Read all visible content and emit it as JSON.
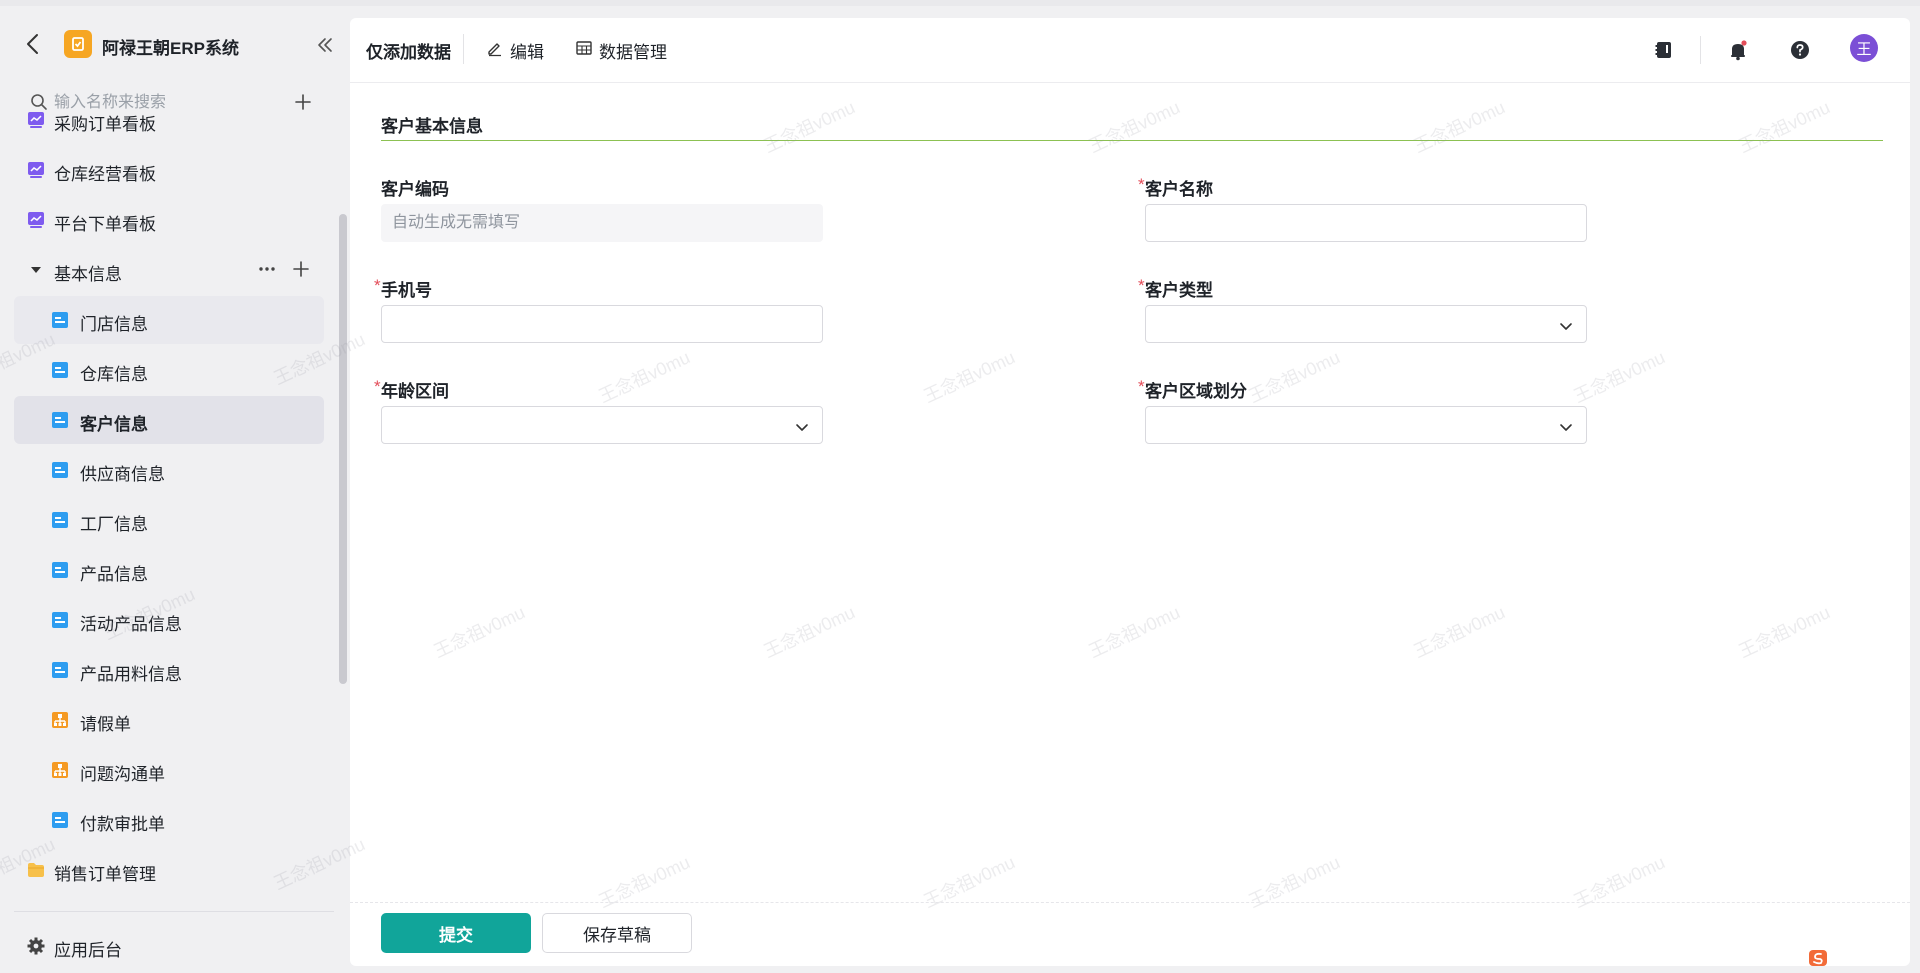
{
  "app": {
    "title": "阿禄王朝ERP系统"
  },
  "search": {
    "placeholder": "输入名称来搜索"
  },
  "sidebar": {
    "items": [
      {
        "label": "采购订单看板",
        "icon": "dashboard-icon"
      },
      {
        "label": "仓库经营看板",
        "icon": "dashboard-icon"
      },
      {
        "label": "平台下单看板",
        "icon": "dashboard-icon"
      },
      {
        "label": "基本信息",
        "icon": "caret-down-icon",
        "group": true
      },
      {
        "label": "门店信息",
        "icon": "form-icon"
      },
      {
        "label": "仓库信息",
        "icon": "form-icon"
      },
      {
        "label": "客户信息",
        "icon": "form-icon",
        "selected": true
      },
      {
        "label": "供应商信息",
        "icon": "form-icon"
      },
      {
        "label": "工厂信息",
        "icon": "form-icon"
      },
      {
        "label": "产品信息",
        "icon": "form-icon"
      },
      {
        "label": "活动产品信息",
        "icon": "form-icon"
      },
      {
        "label": "产品用料信息",
        "icon": "form-icon"
      },
      {
        "label": "请假单",
        "icon": "workflow-icon"
      },
      {
        "label": "问题沟通单",
        "icon": "workflow-icon"
      },
      {
        "label": "付款审批单",
        "icon": "form-icon"
      },
      {
        "label": "销售订单管理",
        "icon": "folder-icon"
      }
    ],
    "footer": {
      "label": "应用后台",
      "icon": "gear-icon"
    }
  },
  "toolbar": {
    "tabs": [
      {
        "label": "仅添加数据",
        "active": true
      },
      {
        "label": "编辑",
        "icon": "edit-icon"
      },
      {
        "label": "数据管理",
        "icon": "table-icon"
      }
    ],
    "avatar": "王"
  },
  "form": {
    "section_title": "客户基本信息",
    "fields": {
      "customer_code": {
        "label": "客户编码",
        "placeholder": "自动生成无需填写",
        "required": false
      },
      "customer_name": {
        "label": "客户名称",
        "value": "",
        "required": true
      },
      "phone": {
        "label": "手机号",
        "value": "",
        "required": true
      },
      "customer_type": {
        "label": "客户类型",
        "value": "",
        "required": true
      },
      "age_range": {
        "label": "年龄区间",
        "value": "",
        "required": true
      },
      "customer_region": {
        "label": "客户区域划分",
        "value": "",
        "required": true
      }
    },
    "required_mark": "*"
  },
  "actions": {
    "submit_label": "提交",
    "draft_label": "保存草稿"
  },
  "watermark": "王念祖v0mu",
  "colors": {
    "accent": "#11a59a",
    "section_line": "#8cc152",
    "required": "#e34d59",
    "selected_bg": "#e2e2e9",
    "avatar": "#7b4fd6",
    "logo": "#f6a623",
    "form_icon": "#2e9df0",
    "dashboard_icon": "#7e5bef",
    "workflow_icon": "#f59a23"
  }
}
